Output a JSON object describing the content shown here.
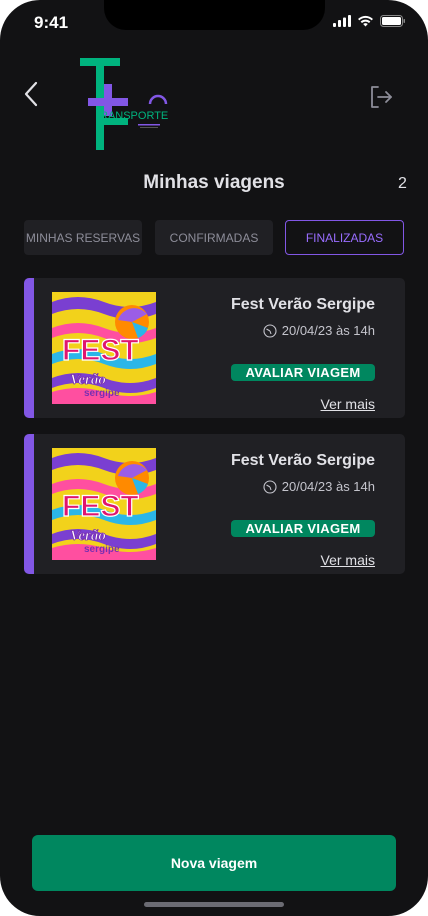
{
  "status_bar": {
    "time": "9:41"
  },
  "header": {
    "logo_text": "RANSPORTE",
    "back_icon": "chevron-left-icon",
    "logout_icon": "sign-out-icon"
  },
  "page": {
    "title": "Minhas viagens",
    "count": "2"
  },
  "tabs": [
    {
      "label": "MINHAS RESERVAS",
      "active": false
    },
    {
      "label": "CONFIRMADAS",
      "active": false
    },
    {
      "label": "FINALIZADAS",
      "active": true
    }
  ],
  "trips": [
    {
      "title": "Fest Verão Sergipe",
      "date": "20/04/23 às 14h",
      "rate_label": "AVALIAR VIAGEM",
      "more_label": "Ver mais",
      "poster_text": [
        "FEST",
        "Verão",
        "sergipe"
      ]
    },
    {
      "title": "Fest Verão Sergipe",
      "date": "20/04/23 às 14h",
      "rate_label": "AVALIAR VIAGEM",
      "more_label": "Ver mais",
      "poster_text": [
        "FEST",
        "Verão",
        "sergipe"
      ]
    }
  ],
  "footer": {
    "new_trip_label": "Nova viagem"
  },
  "colors": {
    "background": "#121214",
    "card": "#202024",
    "accent_purple": "#8257e5",
    "accent_green": "#00875f",
    "logo_green": "#00b37e"
  }
}
